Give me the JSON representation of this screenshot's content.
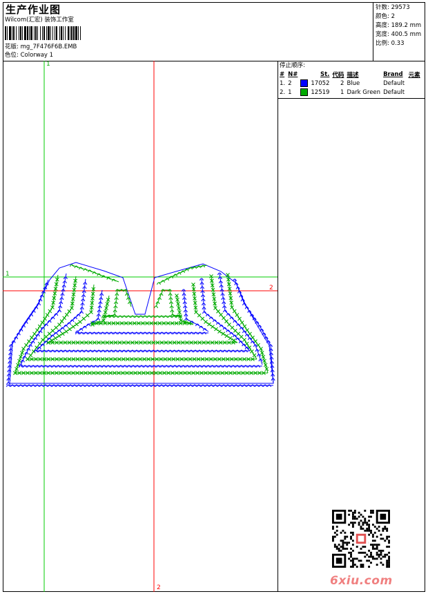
{
  "header": {
    "title": "生产作业图",
    "subtitle": "Wilcom(汇宏) 装饰工作室",
    "file_label": "花版:",
    "file_name": "mg_7F476F6B.EMB",
    "color_label": "色位:",
    "color_name": "Colorway 1"
  },
  "stats": {
    "stitches": "针数: 29573",
    "colors": "颜色: 2",
    "height": "高度: 189.2 mm",
    "width": "宽度: 400.5 mm",
    "scale": "比例: 0.33"
  },
  "stop_sequence": {
    "title": "停止顺序:",
    "columns": [
      "#",
      "N#",
      "St.",
      "代码",
      "描述",
      "Brand",
      "元素"
    ],
    "rows": [
      {
        "idx": "1.",
        "n": "2",
        "color": "#0000ff",
        "stitches": "17052",
        "code": "2",
        "desc": "Blue",
        "brand": "Default",
        "elem": ""
      },
      {
        "idx": "2.",
        "n": "1",
        "color": "#00aa00",
        "stitches": "12519",
        "code": "1",
        "desc": "Dark Green",
        "brand": "Default",
        "elem": ""
      }
    ]
  },
  "axes": {
    "green_v_label": "1",
    "green_h_label": "1",
    "red_h_label": "2",
    "red_v_label": "2",
    "green_color": "#00cc00",
    "red_color": "#ff0000"
  },
  "watermark": {
    "site": "6xiu.com"
  }
}
